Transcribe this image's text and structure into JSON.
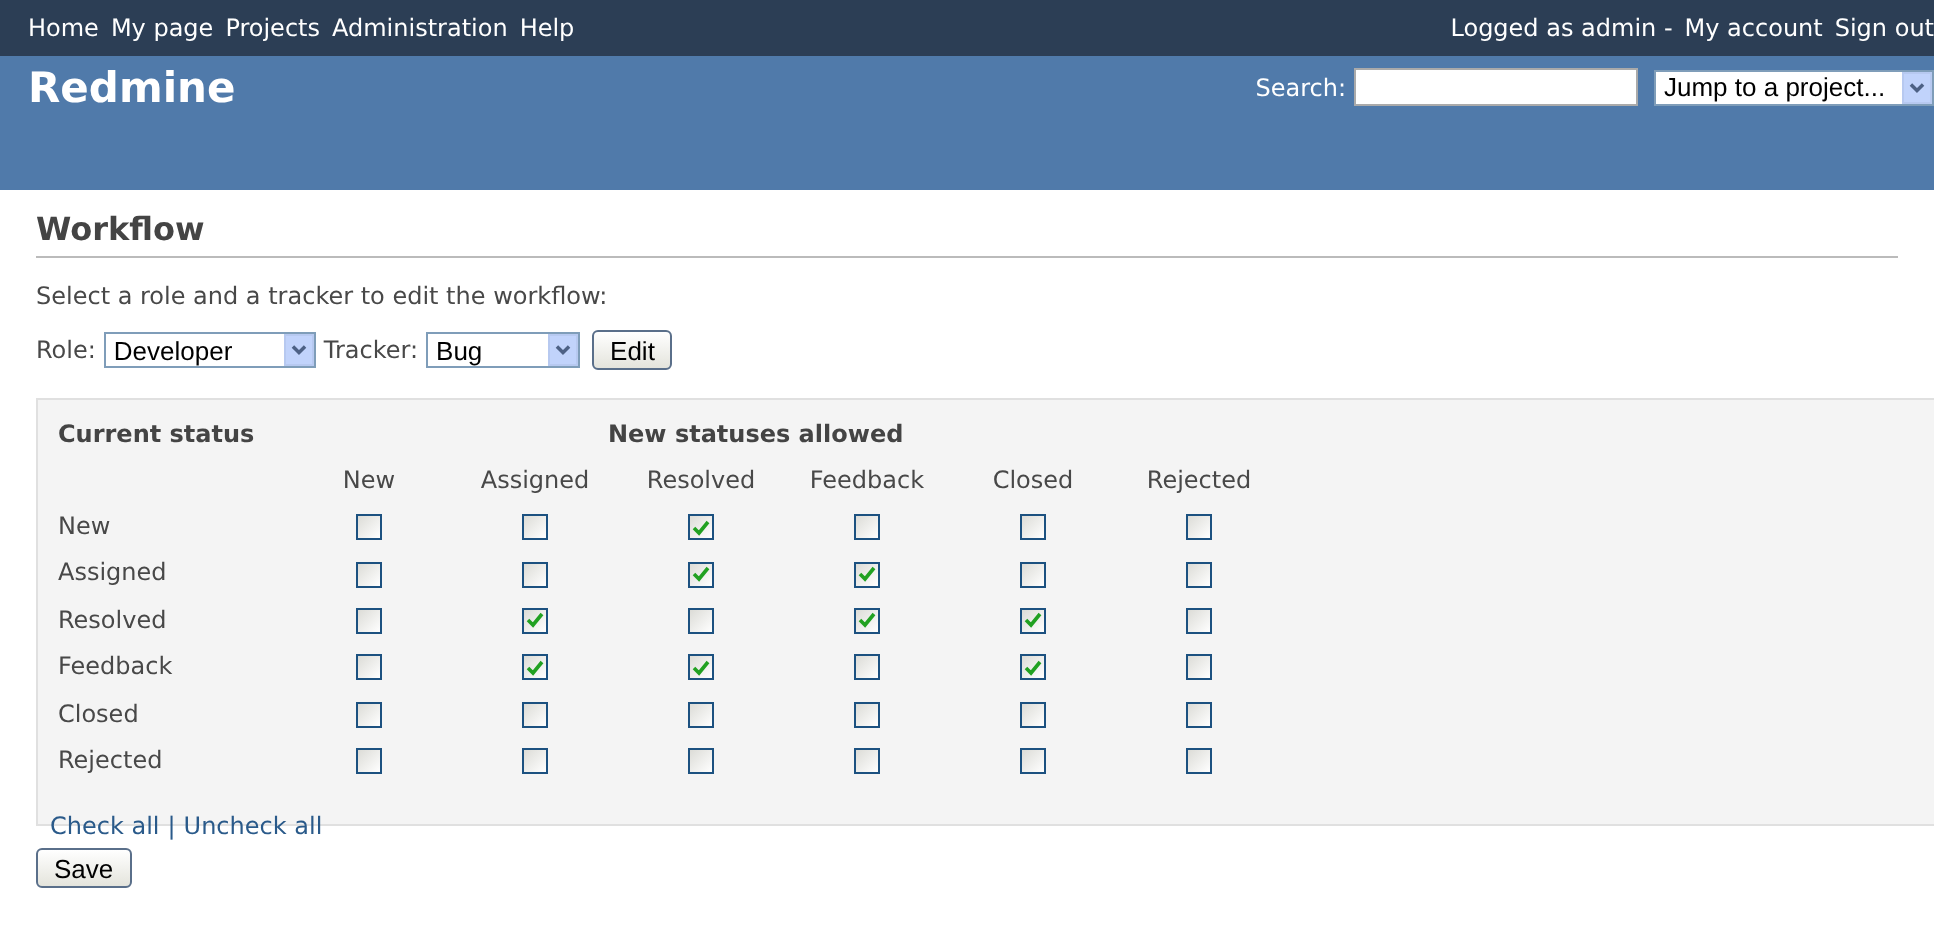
{
  "top_menu": {
    "items": [
      "Home",
      "My page",
      "Projects",
      "Administration",
      "Help"
    ],
    "logged_as": "Logged as admin -",
    "account_links": [
      "My account",
      "Sign out"
    ]
  },
  "header": {
    "title": "Redmine",
    "search": {
      "label": "Search:"
    },
    "project_jump": {
      "value": "Jump to a project..."
    }
  },
  "page": {
    "title": "Workflow",
    "instruction": "Select a role and a tracker to edit the workflow:",
    "role": {
      "label": "Role:",
      "value": "Developer"
    },
    "tracker": {
      "label": "Tracker:",
      "value": "Bug"
    },
    "edit_button": "Edit"
  },
  "workflow": {
    "current_status_heading": "Current status",
    "new_statuses_heading": "New statuses allowed",
    "columns": [
      "New",
      "Assigned",
      "Resolved",
      "Feedback",
      "Closed",
      "Rejected"
    ],
    "rows": [
      {
        "status": "New",
        "allowed": [
          false,
          false,
          true,
          false,
          false,
          false
        ]
      },
      {
        "status": "Assigned",
        "allowed": [
          false,
          false,
          true,
          true,
          false,
          false
        ]
      },
      {
        "status": "Resolved",
        "allowed": [
          false,
          true,
          false,
          true,
          true,
          false
        ]
      },
      {
        "status": "Feedback",
        "allowed": [
          false,
          true,
          true,
          false,
          true,
          false
        ]
      },
      {
        "status": "Closed",
        "allowed": [
          false,
          false,
          false,
          false,
          false,
          false
        ]
      },
      {
        "status": "Rejected",
        "allowed": [
          false,
          false,
          false,
          false,
          false,
          false
        ]
      }
    ],
    "check_all": "Check all",
    "separator": "|",
    "uncheck_all": "Uncheck all"
  },
  "save_button": "Save"
}
